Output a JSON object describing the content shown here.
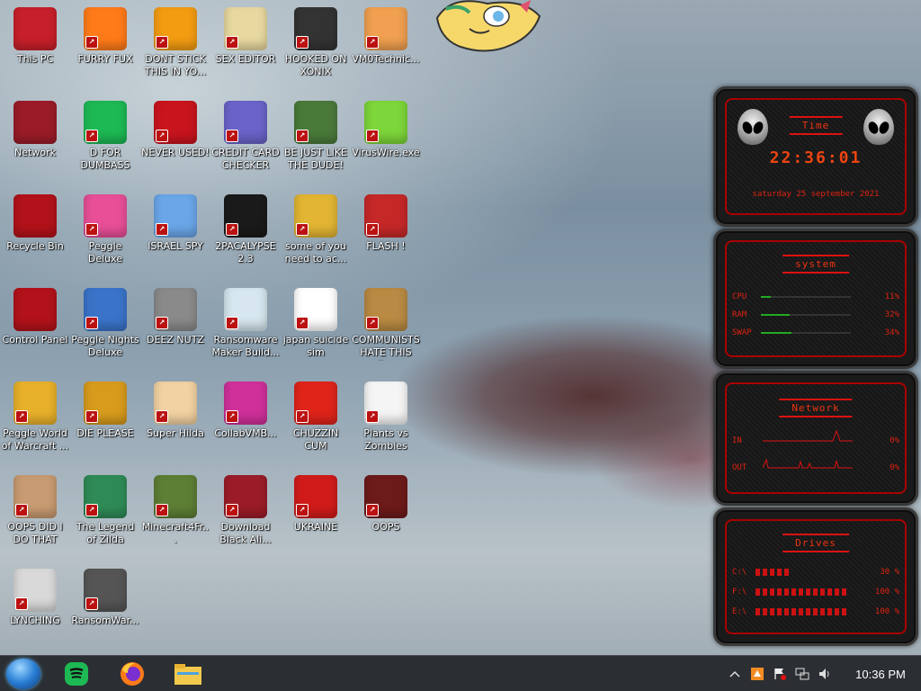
{
  "desktop": {
    "icons": [
      {
        "label": "This PC",
        "icon": "computer-icon",
        "color": "#c8202a"
      },
      {
        "label": "FURRY FUX",
        "icon": "firefox-icon",
        "color": "#ff7b19"
      },
      {
        "label": "DONT STICK THIS IN YO...",
        "icon": "traffic-cone-icon",
        "color": "#f39c12"
      },
      {
        "label": "SEX EDITOR",
        "icon": "hxd-icon",
        "color": "#e8d9a0"
      },
      {
        "label": "HOOKED ON XONIX",
        "icon": "game-icon",
        "color": "#333333"
      },
      {
        "label": "VM0Technic...",
        "icon": "person-icon",
        "color": "#f0a050"
      },
      {
        "label": "Network",
        "icon": "alien-orb-icon",
        "color": "#9b1c28"
      },
      {
        "label": "D FOR DUMBASS",
        "icon": "spotify-icon",
        "color": "#1db954"
      },
      {
        "label": "NEVER USED!",
        "icon": "devcpp-icon",
        "color": "#c9141d"
      },
      {
        "label": "CREDIT CARD CHECKER",
        "icon": "card-icon",
        "color": "#6b63c9"
      },
      {
        "label": "BE JUST LIKE THE DUDE!",
        "icon": "santa-icon",
        "color": "#4a7a3a"
      },
      {
        "label": "VirusWire.exe",
        "icon": "lime-icon",
        "color": "#7dd63a"
      },
      {
        "label": "Recycle Bin",
        "icon": "bin-icon",
        "color": "#b3121a"
      },
      {
        "label": "Peggle Deluxe",
        "icon": "peggle-icon",
        "color": "#e84f97"
      },
      {
        "label": "ISRAEL SPY",
        "icon": "network-spy-icon",
        "color": "#6aa6e8"
      },
      {
        "label": "2PACALYPSE 2.3",
        "icon": "terminal-icon",
        "color": "#1a1a1a"
      },
      {
        "label": "some of you need to ac...",
        "icon": "dog-icon",
        "color": "#e2b533"
      },
      {
        "label": "FLASH !",
        "icon": "flash-icon",
        "color": "#c62828"
      },
      {
        "label": "Control Panel",
        "icon": "control-panel-icon",
        "color": "#b3121a"
      },
      {
        "label": "Peggle Nights Deluxe",
        "icon": "peggle-nights-icon",
        "color": "#3a74c9"
      },
      {
        "label": "DEEZ NUTZ",
        "icon": "windows-stack-icon",
        "color": "#8a8a8a"
      },
      {
        "label": "Ransomware Maker Build...",
        "icon": "window-app-icon",
        "color": "#d7e6ef"
      },
      {
        "label": "japan suicide sim",
        "icon": "japan-sim-icon",
        "color": "#ffffff"
      },
      {
        "label": "COMMUNISTS HATE THIS G...",
        "icon": "money-bag-icon",
        "color": "#b98a43"
      },
      {
        "label": "Peggle World of Warcraft ...",
        "icon": "peggle-wow-icon",
        "color": "#e8b12b"
      },
      {
        "label": "DIE PLEASE",
        "icon": "de-icon",
        "color": "#d89b1c"
      },
      {
        "label": "Super Hilda",
        "icon": "pixel-cat-icon",
        "color": "#f2d2a2"
      },
      {
        "label": "CollabVMB...",
        "icon": "monitor-icon",
        "color": "#d0309a"
      },
      {
        "label": "CHUZZIN CUM",
        "icon": "chuzzle-icon",
        "color": "#e0241a"
      },
      {
        "label": "Plants vs Zombies",
        "icon": "flower-icon",
        "color": "#f5f5f5"
      },
      {
        "label": "OOPS DID I DO THAT",
        "icon": "portrait-icon",
        "color": "#c89b72"
      },
      {
        "label": "The Legend of Zilda",
        "icon": "link-icon",
        "color": "#2e8b57"
      },
      {
        "label": "Minecraft4Fr...",
        "icon": "grass-block-icon",
        "color": "#5d7e35"
      },
      {
        "label": "Download Black Ali...",
        "icon": "alien-orb-icon",
        "color": "#9b1c28"
      },
      {
        "label": "UKRAINE",
        "icon": "radiation-icon",
        "color": "#d11b1b"
      },
      {
        "label": "OOPS",
        "icon": "red-box-icon",
        "color": "#6d1a1a"
      },
      {
        "label": "LYNCHING",
        "icon": "gear-noose-icon",
        "color": "#d9d9d9"
      },
      {
        "label": "RansomWar...",
        "icon": "skull-icon",
        "color": "#555555"
      }
    ]
  },
  "widgets": {
    "time": {
      "title": "time",
      "value": "22:36:01",
      "date": "saturday 25 september 2021"
    },
    "system": {
      "title": "system",
      "rows": [
        {
          "label": "CPU",
          "value": "11%",
          "level": 0.11
        },
        {
          "label": "RAM",
          "value": "32%",
          "level": 0.32
        },
        {
          "label": "SWAP",
          "value": "34%",
          "level": 0.34
        }
      ]
    },
    "network": {
      "title": "network",
      "rows": [
        {
          "label": "IN",
          "value": "0%"
        },
        {
          "label": "OUT",
          "value": "0%"
        }
      ]
    },
    "drives": {
      "title": "drives",
      "rows": [
        {
          "label": "C:\\",
          "value": "30 %"
        },
        {
          "label": "F:\\",
          "value": "100 %"
        },
        {
          "label": "E:\\",
          "value": "100 %"
        }
      ]
    }
  },
  "taskbar": {
    "start": "start-orb-icon",
    "pinned": [
      {
        "name": "spotify-icon",
        "color": "#1db954"
      },
      {
        "name": "firefox-icon",
        "color": "#ff7b19"
      },
      {
        "name": "file-explorer-icon",
        "color": "#f2c94c"
      }
    ],
    "clock": "10:36 PM"
  }
}
